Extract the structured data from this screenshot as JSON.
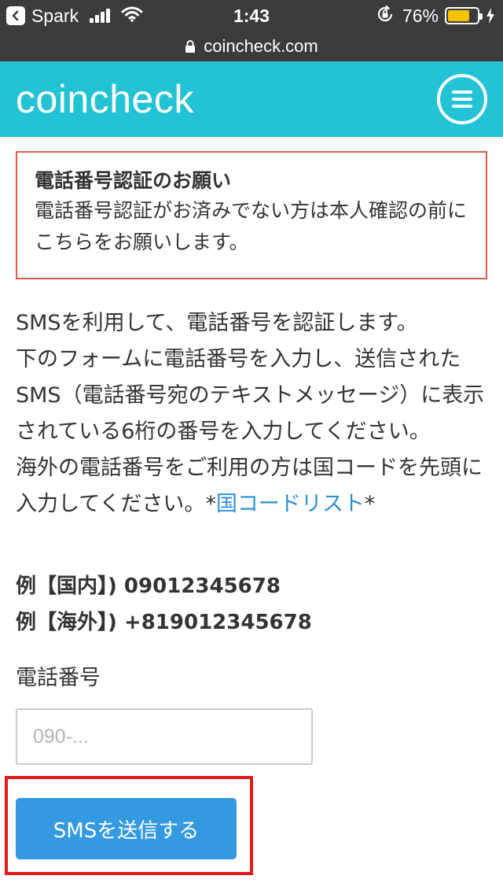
{
  "status_bar": {
    "back_app": "Spark",
    "time": "1:43",
    "battery_percent": "76%",
    "battery_level": 0.76
  },
  "url_bar": {
    "domain": "coincheck.com"
  },
  "header": {
    "logo": "coincheck"
  },
  "notice": {
    "title": "電話番号認証のお願い",
    "body": "電話番号認証がお済みでない方は本人確認の前にこちらをお願いします。"
  },
  "description": {
    "line1": "SMSを利用して、電話番号を認証します。",
    "line2": "下のフォームに電話番号を入力し、送信されたSMS（電話番号宛のテキストメッセージ）に表示されている6桁の番号を入力してください。",
    "line3_prefix": "海外の電話番号をご利用の方は国コードを先頭に入力してください。*",
    "country_code_link": "国コードリスト",
    "line3_suffix": "*"
  },
  "examples": {
    "domestic": "例【国内】) 09012345678",
    "overseas": "例【海外】) +819012345678"
  },
  "form": {
    "phone_label": "電話番号",
    "phone_placeholder": "090-...",
    "phone_value": "",
    "submit_label": "SMSを送信する"
  },
  "colors": {
    "brand_header": "#23c3d6",
    "notice_border": "#e05a4c",
    "button": "#3399e0",
    "link": "#2e8fd6",
    "highlight": "#e01b1b"
  }
}
